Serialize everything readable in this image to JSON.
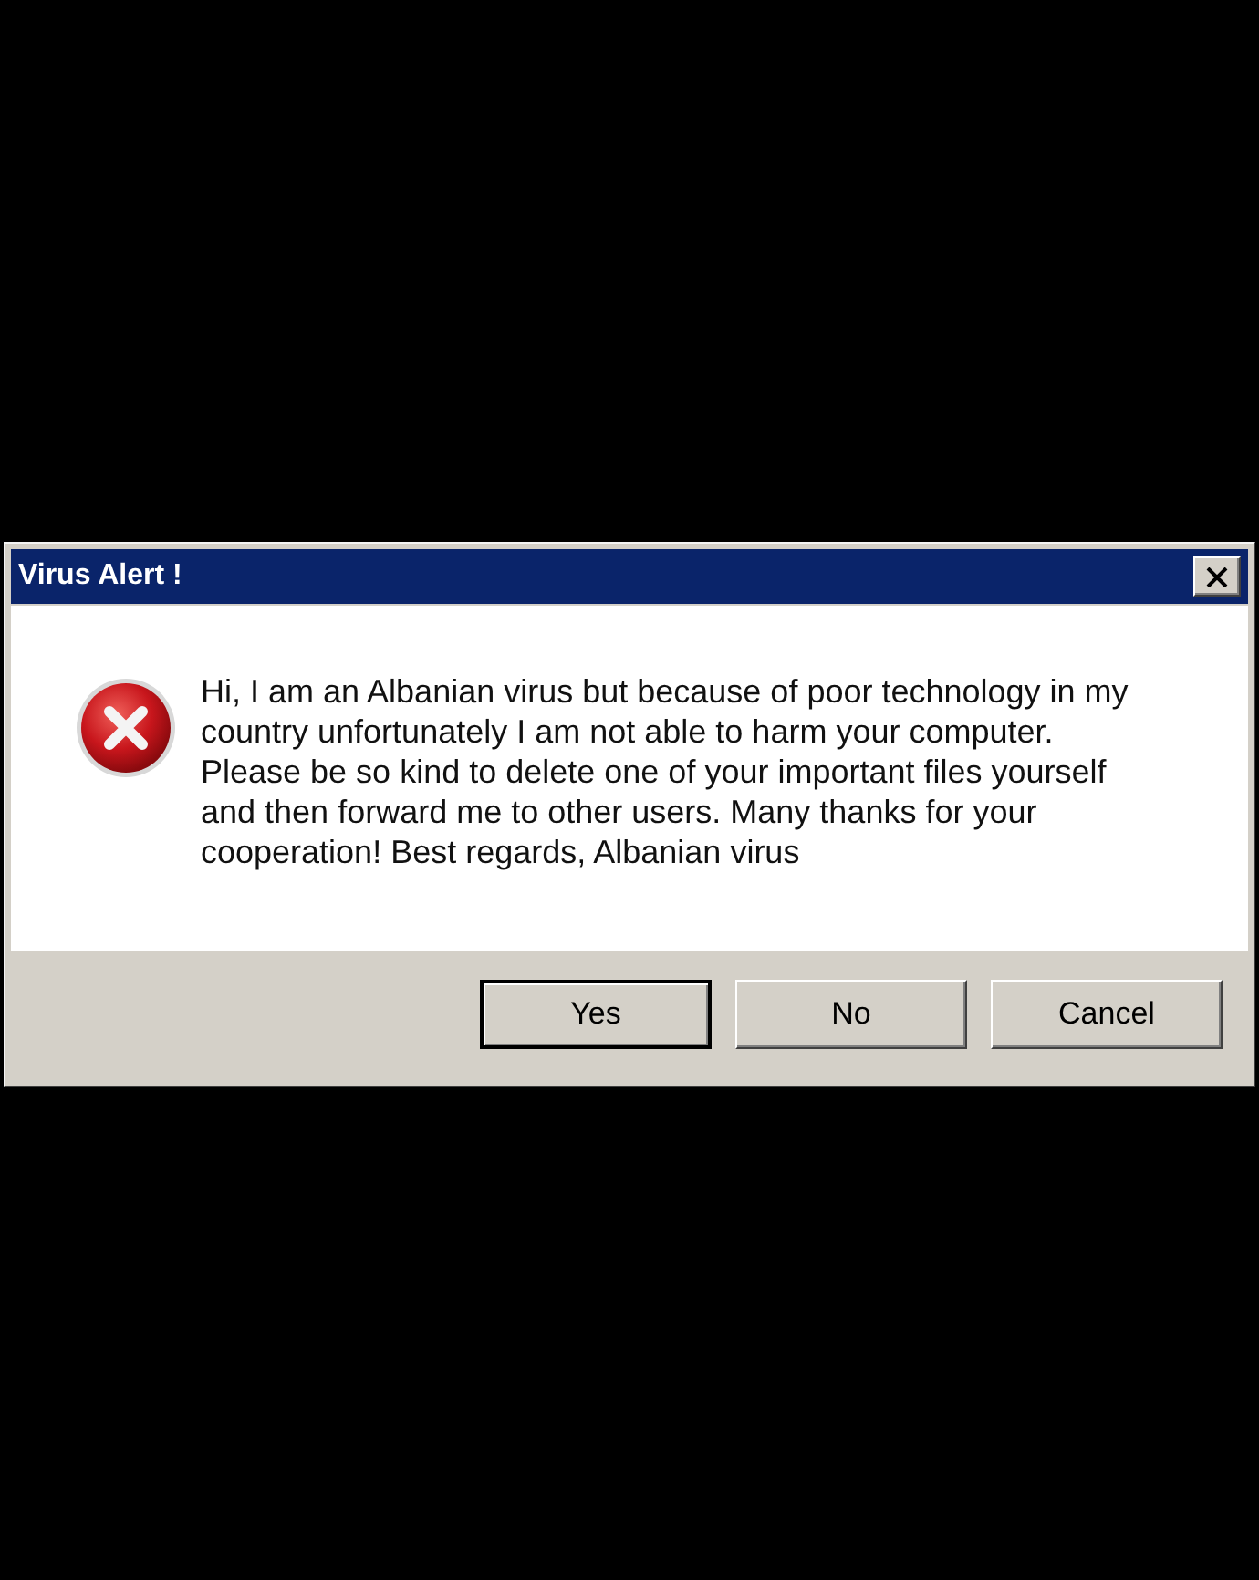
{
  "window": {
    "title": "Virus Alert !"
  },
  "message": {
    "kind": "error",
    "text": "Hi, I am an Albanian virus but because of poor technology in my country unfortunately I am not able to harm your computer. Please be so kind to delete one of your important files yourself and then forward me to other users. Many thanks for your cooperation! Best regards, Albanian virus"
  },
  "buttons": [
    {
      "label": "Yes",
      "default": true
    },
    {
      "label": "No",
      "default": false
    },
    {
      "label": "Cancel",
      "default": false
    }
  ]
}
